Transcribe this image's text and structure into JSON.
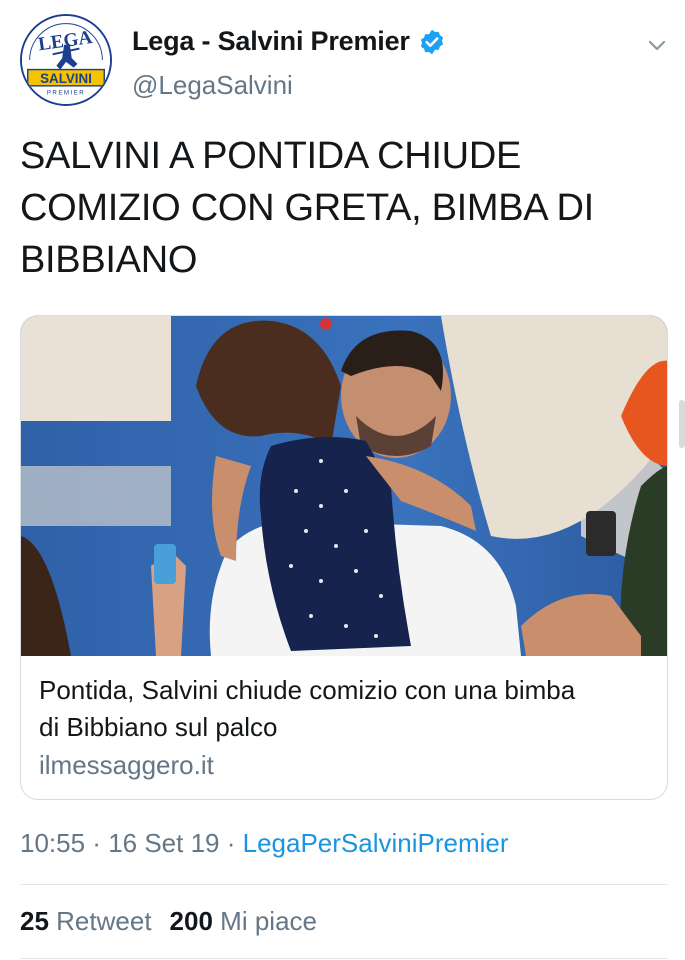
{
  "account": {
    "display_name": "Lega - Salvini Premier",
    "handle": "@LegaSalvini",
    "verified_icon": "verified-badge-icon",
    "avatar": {
      "logo_top_text": "LEGA",
      "logo_banner_text": "SALVINI",
      "logo_bottom_text": "PREMIER",
      "colors": {
        "blue": "#1d3f8f",
        "yellow": "#f5c400",
        "red": "#d0202a"
      }
    }
  },
  "menu": {
    "icon": "chevron-down-icon"
  },
  "tweet": {
    "text_lines": [
      "SALVINI A PONTIDA CHIUDE",
      "COMIZIO CON GRETA, BIMBA DI",
      "BIBBIANO"
    ]
  },
  "card": {
    "title_lines": [
      "Pontida, Salvini chiude comizio con una bimba",
      "di Bibbiano sul palco"
    ],
    "domain": "ilmessaggero.it"
  },
  "meta": {
    "time": "10:55",
    "separator": " · ",
    "date": "16 Set 19",
    "source": "LegaPerSalviniPremier"
  },
  "stats": {
    "retweets_count": "25",
    "retweets_label": "Retweet",
    "likes_count": "200",
    "likes_label": "Mi piace"
  },
  "colors": {
    "text": "#14171a",
    "secondary": "#657786",
    "link": "#1b95e0",
    "verified": "#1da1f2",
    "border": "#e1e8ed"
  }
}
